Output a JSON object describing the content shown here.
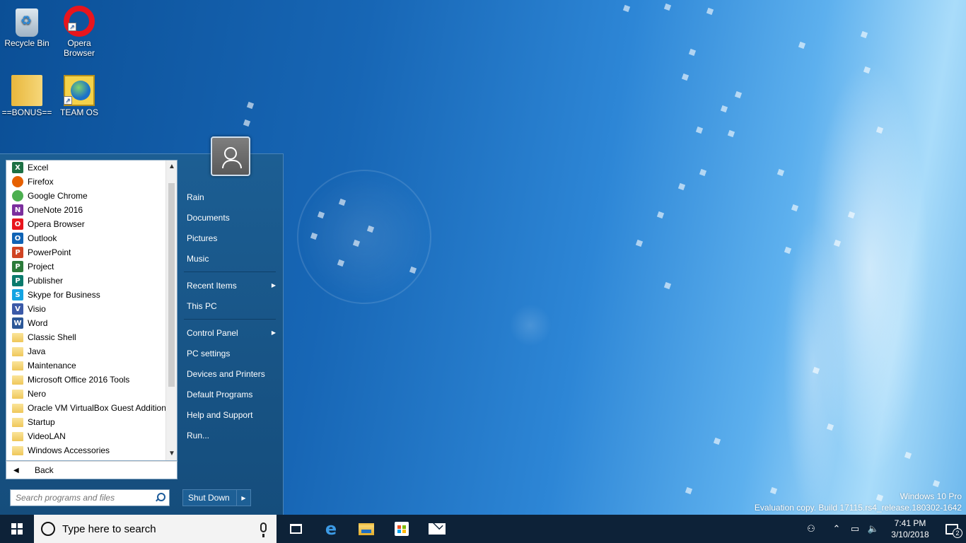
{
  "desktop": {
    "icons": [
      {
        "label": "Recycle Bin",
        "icon": "recycle-bin-icon"
      },
      {
        "label": "Opera Browser",
        "icon": "opera-icon"
      },
      {
        "label": "==BONUS==",
        "icon": "folder-icon"
      },
      {
        "label": "TEAM OS",
        "icon": "team-os-icon"
      }
    ]
  },
  "start_menu": {
    "programs": [
      {
        "label": "Excel",
        "icon_letter": "X",
        "color": "#1d7044"
      },
      {
        "label": "Firefox",
        "icon_letter": "",
        "color": "#e66000"
      },
      {
        "label": "Google Chrome",
        "icon_letter": "",
        "color": "#4caf50"
      },
      {
        "label": "OneNote 2016",
        "icon_letter": "N",
        "color": "#7b2f9d"
      },
      {
        "label": "Opera Browser",
        "icon_letter": "O",
        "color": "#e8151d"
      },
      {
        "label": "Outlook",
        "icon_letter": "O",
        "color": "#0f63b5"
      },
      {
        "label": "PowerPoint",
        "icon_letter": "P",
        "color": "#d04423"
      },
      {
        "label": "Project",
        "icon_letter": "P",
        "color": "#2b7a3a"
      },
      {
        "label": "Publisher",
        "icon_letter": "P",
        "color": "#0a7a6c"
      },
      {
        "label": "Skype for Business",
        "icon_letter": "S",
        "color": "#13a3e2"
      },
      {
        "label": "Visio",
        "icon_letter": "V",
        "color": "#3b5aa8"
      },
      {
        "label": "Word",
        "icon_letter": "W",
        "color": "#2b5797"
      },
      {
        "label": "Classic Shell",
        "folder": true
      },
      {
        "label": "Java",
        "folder": true
      },
      {
        "label": "Maintenance",
        "folder": true
      },
      {
        "label": "Microsoft Office 2016 Tools",
        "folder": true
      },
      {
        "label": "Nero",
        "folder": true
      },
      {
        "label": "Oracle VM VirtualBox Guest Additions",
        "folder": true
      },
      {
        "label": "Startup",
        "folder": true
      },
      {
        "label": "VideoLAN",
        "folder": true
      },
      {
        "label": "Windows Accessories",
        "folder": true
      }
    ],
    "back_label": "Back",
    "search_placeholder": "Search programs and files",
    "right_items": {
      "rain": "Rain",
      "documents": "Documents",
      "pictures": "Pictures",
      "music": "Music",
      "recent_items": "Recent Items",
      "this_pc": "This PC",
      "control_panel": "Control Panel",
      "pc_settings": "PC settings",
      "devices_printers": "Devices and Printers",
      "default_programs": "Default Programs",
      "help_support": "Help and Support",
      "run": "Run..."
    },
    "shutdown_label": "Shut Down"
  },
  "watermark": {
    "line1": "Windows 10 Pro",
    "line2": "Evaluation copy. Build 17115.rs4_release.180302-1642"
  },
  "taskbar": {
    "search_placeholder": "Type here to search",
    "time": "7:41 PM",
    "date": "3/10/2018",
    "notification_count": "2"
  }
}
